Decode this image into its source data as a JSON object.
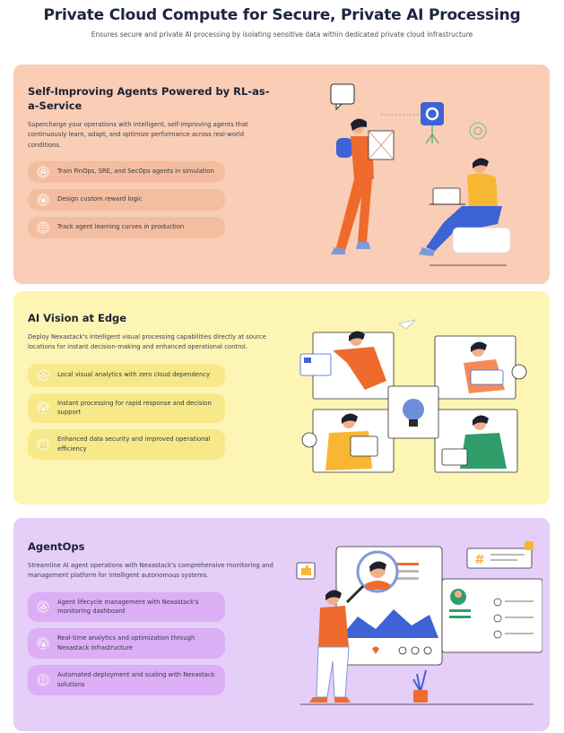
{
  "header": {
    "title": "Private Cloud Compute for Secure, Private AI Processing",
    "subtitle": "Ensures secure and private AI processing by isolating sensitive data within dedicated private cloud infrastructure"
  },
  "sections": [
    {
      "title": "Self-Improving Agents Powered by RL-as-a-Service",
      "description": "Supercharge your operations with intelligent, self-improving agents that continuously learn, adapt, and optimize performance across real-world conditions.",
      "background": "#f9cdb6",
      "chip": "#f4bd9f",
      "features": [
        {
          "icon": "cube-icon",
          "text": "Train FinOps, SRE, and SecOps agents in simulation"
        },
        {
          "icon": "triangle-icon",
          "text": "Design custom reward logic"
        },
        {
          "icon": "layers-icon",
          "text": "Track agent learning curves in production"
        }
      ]
    },
    {
      "title": "AI Vision at Edge",
      "description": "Deploy Nexastack's intelligent visual processing capabilities directly at source locations for instant decision-making and enhanced operational control.",
      "background": "#fdf5b4",
      "chip": "#f7e98a",
      "features": [
        {
          "icon": "cube-icon",
          "text": "Local visual analytics with zero cloud dependency"
        },
        {
          "icon": "triangle-icon",
          "text": "Instant processing for rapid response and decision support"
        },
        {
          "icon": "layers-icon",
          "text": "Enhanced data security and improved operational efficiency"
        }
      ]
    },
    {
      "title": "AgentOps",
      "description": "Streamline AI agent operations with Nexastack's comprehensive monitoring and management platform for intelligent autonomous systems.",
      "background": "#e5cef8",
      "chip": "#dbaef5",
      "features": [
        {
          "icon": "cube-icon",
          "text": "Agent lifecycle management with Nexastack's monitoring dashboard"
        },
        {
          "icon": "triangle-icon",
          "text": "Real-time analytics and optimization through Nexastack infrastructure"
        },
        {
          "icon": "layers-icon",
          "text": "Automated deployment and scaling with Nexastack solutions"
        }
      ]
    }
  ]
}
